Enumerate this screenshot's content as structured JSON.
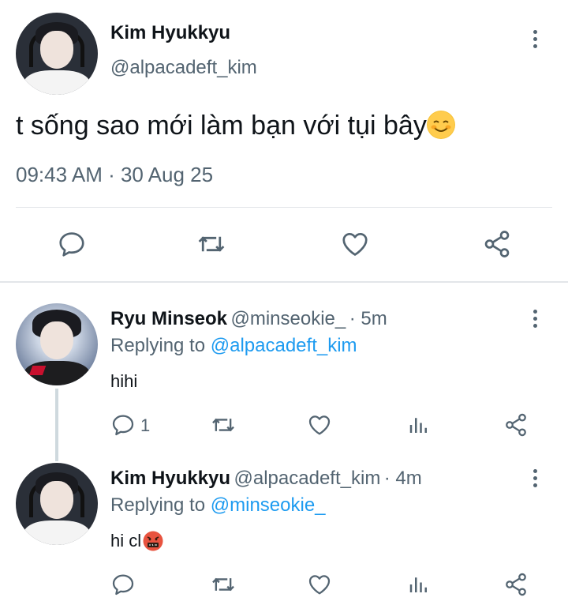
{
  "main_tweet": {
    "author_name": "Kim Hyukkyu",
    "handle": "@alpacadeft_kim",
    "text": "t sống sao mới làm bạn với tụi bây",
    "emoji": "☺️",
    "timestamp": "09:43 AM · 30 Aug 25",
    "actions": [
      "reply-icon",
      "retweet-icon",
      "like-icon",
      "share-icon"
    ]
  },
  "replies": [
    {
      "author_name": "Ryu Minseok",
      "handle": "@minseokie_",
      "time": "· 5m",
      "replying_label": "Replying to ",
      "replying_to": "@alpacadeft_kim",
      "text": "hihi",
      "reply_count": "1",
      "actions": [
        "reply-icon",
        "retweet-icon",
        "like-icon",
        "stats-icon",
        "share-icon"
      ]
    },
    {
      "author_name": "Kim Hyukkyu",
      "handle": "@alpacadeft_kim",
      "time": "· 4m",
      "replying_label": "Replying to ",
      "replying_to": "@minseokie_",
      "text": "hi cl",
      "emoji": "🤬",
      "reply_count": "",
      "actions": [
        "reply-icon",
        "retweet-icon",
        "like-icon",
        "stats-icon",
        "share-icon"
      ]
    }
  ],
  "colors": {
    "text": "#0f1419",
    "muted": "#536471",
    "link": "#1d9bf0",
    "divider": "#e3e6e9"
  }
}
